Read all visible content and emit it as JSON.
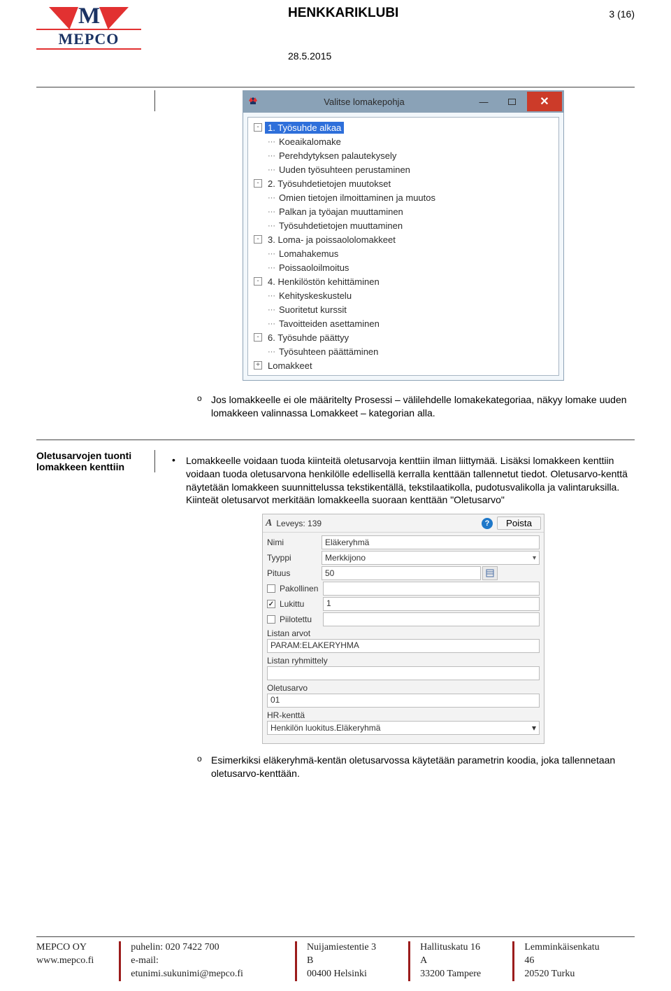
{
  "header": {
    "docTitle": "HENKKARIKLUBI",
    "date": "28.5.2015",
    "pageIndicator": "3 (16)",
    "logoText": "MEPCO"
  },
  "dialog1": {
    "title": "Valitse lomakepohja",
    "tree": [
      {
        "level": 1,
        "expander": "-",
        "label": "1. Työsuhde alkaa",
        "selected": true
      },
      {
        "level": 2,
        "expander": "",
        "label": "Koeaikalomake"
      },
      {
        "level": 2,
        "expander": "",
        "label": "Perehdytyksen palautekysely"
      },
      {
        "level": 2,
        "expander": "",
        "label": "Uuden työsuhteen perustaminen"
      },
      {
        "level": 1,
        "expander": "-",
        "label": "2. Työsuhdetietojen muutokset"
      },
      {
        "level": 2,
        "expander": "",
        "label": "Omien tietojen ilmoittaminen ja muutos"
      },
      {
        "level": 2,
        "expander": "",
        "label": "Palkan ja työajan muuttaminen"
      },
      {
        "level": 2,
        "expander": "",
        "label": "Työsuhdetietojen muuttaminen"
      },
      {
        "level": 1,
        "expander": "-",
        "label": "3. Loma- ja poissaololomakkeet"
      },
      {
        "level": 2,
        "expander": "",
        "label": "Lomahakemus"
      },
      {
        "level": 2,
        "expander": "",
        "label": "Poissaoloilmoitus"
      },
      {
        "level": 1,
        "expander": "-",
        "label": "4. Henkilöstön kehittäminen"
      },
      {
        "level": 2,
        "expander": "",
        "label": "Kehityskeskustelu"
      },
      {
        "level": 2,
        "expander": "",
        "label": "Suoritetut kurssit"
      },
      {
        "level": 2,
        "expander": "",
        "label": "Tavoitteiden asettaminen"
      },
      {
        "level": 1,
        "expander": "-",
        "label": "6. Työsuhde päättyy"
      },
      {
        "level": 2,
        "expander": "",
        "label": "Työsuhteen päättäminen"
      },
      {
        "level": 1,
        "expander": "+",
        "label": "Lomakkeet"
      }
    ]
  },
  "section1": {
    "bulletText": "Jos lomakkeelle ei ole määritelty Prosessi – välilehdelle lomakekategoriaa, näkyy lomake uuden lomakkeen valinnassa Lomakkeet – kategorian alla."
  },
  "section2": {
    "heading": "Oletusarvojen tuonti lomakkeen kenttiin",
    "paragraph": "Lomakkeelle voidaan tuoda kiinteitä oletusarvoja kenttiin ilman liittymää. Lisäksi lomakkeen kenttiin voidaan tuoda oletusarvona henkilölle edellisellä kerralla kenttään tallennetut tiedot. Oletusarvo-kenttä näytetään lomakkeen suunnittelussa tekstikentällä, tekstilaatikolla, pudotusvalikolla ja valintaruksilla. Kiinteät oletusarvot merkitään lomakkeella suoraan kenttään \"Oletusarvo\""
  },
  "panel2": {
    "leveysLabel": "Leveys: 139",
    "poistaLabel": "Poista",
    "fields": {
      "nimiLabel": "Nimi",
      "nimiValue": "Eläkeryhmä",
      "tyyppiLabel": "Tyyppi",
      "tyyppiValue": "Merkkijono",
      "pituusLabel": "Pituus",
      "pituusValue": "50",
      "pakollinenLabel": "Pakollinen",
      "pakollinenChecked": false,
      "lukittuLabel": "Lukittu",
      "lukittuChecked": true,
      "lukittuValue": "1",
      "piilotettuLabel": "Piilotettu",
      "piilotettuChecked": false,
      "listanArvotLabel": "Listan arvot",
      "listanArvotValue": "PARAM:ELAKERYHMA",
      "listanRyhmittelyLabel": "Listan ryhmittely",
      "listanRyhmittelyValue": "",
      "oletusarvoLabel": "Oletusarvo",
      "oletusarvoValue": "01",
      "hrkenttaLabel": "HR-kenttä",
      "hrkenttaValue": "Henkilön luokitus.Eläkeryhmä"
    }
  },
  "section3": {
    "bulletText": "Esimerkiksi eläkeryhmä-kentän oletusarvossa käytetään parametrin koodia, joka tallennetaan oletusarvo-kenttään."
  },
  "footer": {
    "col1": {
      "line1": "MEPCO OY",
      "line2": "www.mepco.fi"
    },
    "col2": {
      "line1": "puhelin: 020 7422 700",
      "line2": "e-mail: etunimi.sukunimi@mepco.fi"
    },
    "col3": {
      "line1": "Nuijamiestentie 3 B",
      "line2": "00400 Helsinki"
    },
    "col4": {
      "line1": "Hallituskatu 16 A",
      "line2": "33200 Tampere"
    },
    "col5": {
      "line1": "Lemminkäisenkatu 46",
      "line2": "20520 Turku"
    }
  }
}
